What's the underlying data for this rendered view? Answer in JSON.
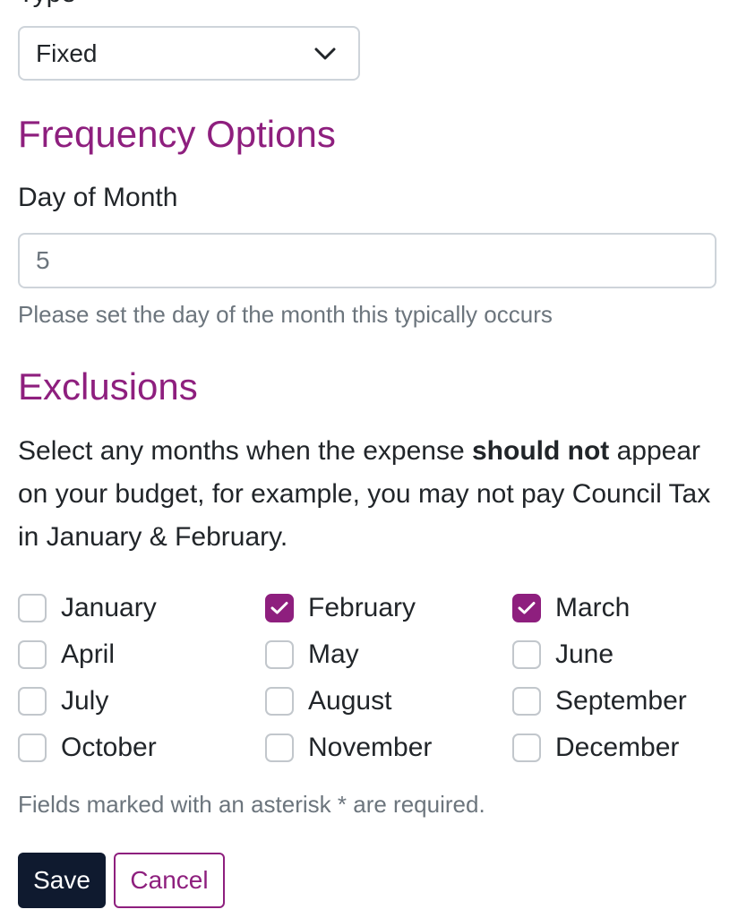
{
  "type_field": {
    "label": "Type",
    "value": "Fixed"
  },
  "frequency": {
    "heading": "Frequency Options",
    "day_label": "Day of Month",
    "day_value": "5",
    "help": "Please set the day of the month this typically occurs"
  },
  "exclusions": {
    "heading": "Exclusions",
    "text_before": "Select any months when the expense ",
    "text_bold": "should not",
    "text_after": " appear on your budget, for example, you may not pay Council Tax in January & February.",
    "months": [
      {
        "label": "January",
        "checked": false
      },
      {
        "label": "February",
        "checked": true
      },
      {
        "label": "March",
        "checked": true
      },
      {
        "label": "April",
        "checked": false
      },
      {
        "label": "May",
        "checked": false
      },
      {
        "label": "June",
        "checked": false
      },
      {
        "label": "July",
        "checked": false
      },
      {
        "label": "August",
        "checked": false
      },
      {
        "label": "September",
        "checked": false
      },
      {
        "label": "October",
        "checked": false
      },
      {
        "label": "November",
        "checked": false
      },
      {
        "label": "December",
        "checked": false
      }
    ]
  },
  "required_note": "Fields marked with an asterisk * are required.",
  "actions": {
    "save_label": "Save",
    "cancel_label": "Cancel"
  },
  "colors": {
    "accent": "#8e1f7e",
    "primary_button": "#0f1a2f",
    "muted_text": "#6c757d"
  }
}
